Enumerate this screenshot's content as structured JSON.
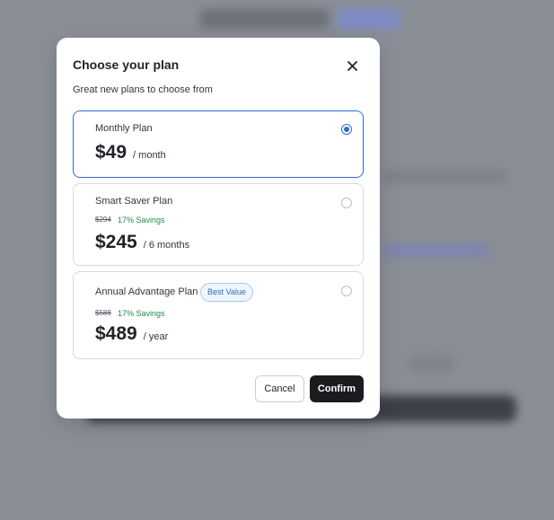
{
  "modal": {
    "title": "Choose your plan",
    "subtitle": "Great new plans to choose from",
    "close_icon": "close-icon"
  },
  "plans": [
    {
      "name": "Monthly Plan",
      "price": "$49",
      "period": "/ month",
      "selected": true
    },
    {
      "name": "Smart Saver Plan",
      "original_price": "$294",
      "savings": "17% Savings",
      "price": "$245",
      "period": "/ 6 months",
      "selected": false
    },
    {
      "name": "Annual Advantage Plan",
      "badge": "Best Value",
      "original_price": "$588",
      "savings": "17% Savings",
      "price": "$489",
      "period": "/ year",
      "selected": false
    }
  ],
  "actions": {
    "cancel_label": "Cancel",
    "confirm_label": "Confirm"
  },
  "colors": {
    "accent": "#2f6fc6",
    "savings": "#1f8a4c",
    "confirm_bg": "#1b1c1f",
    "overlay": "#8b8f97"
  }
}
